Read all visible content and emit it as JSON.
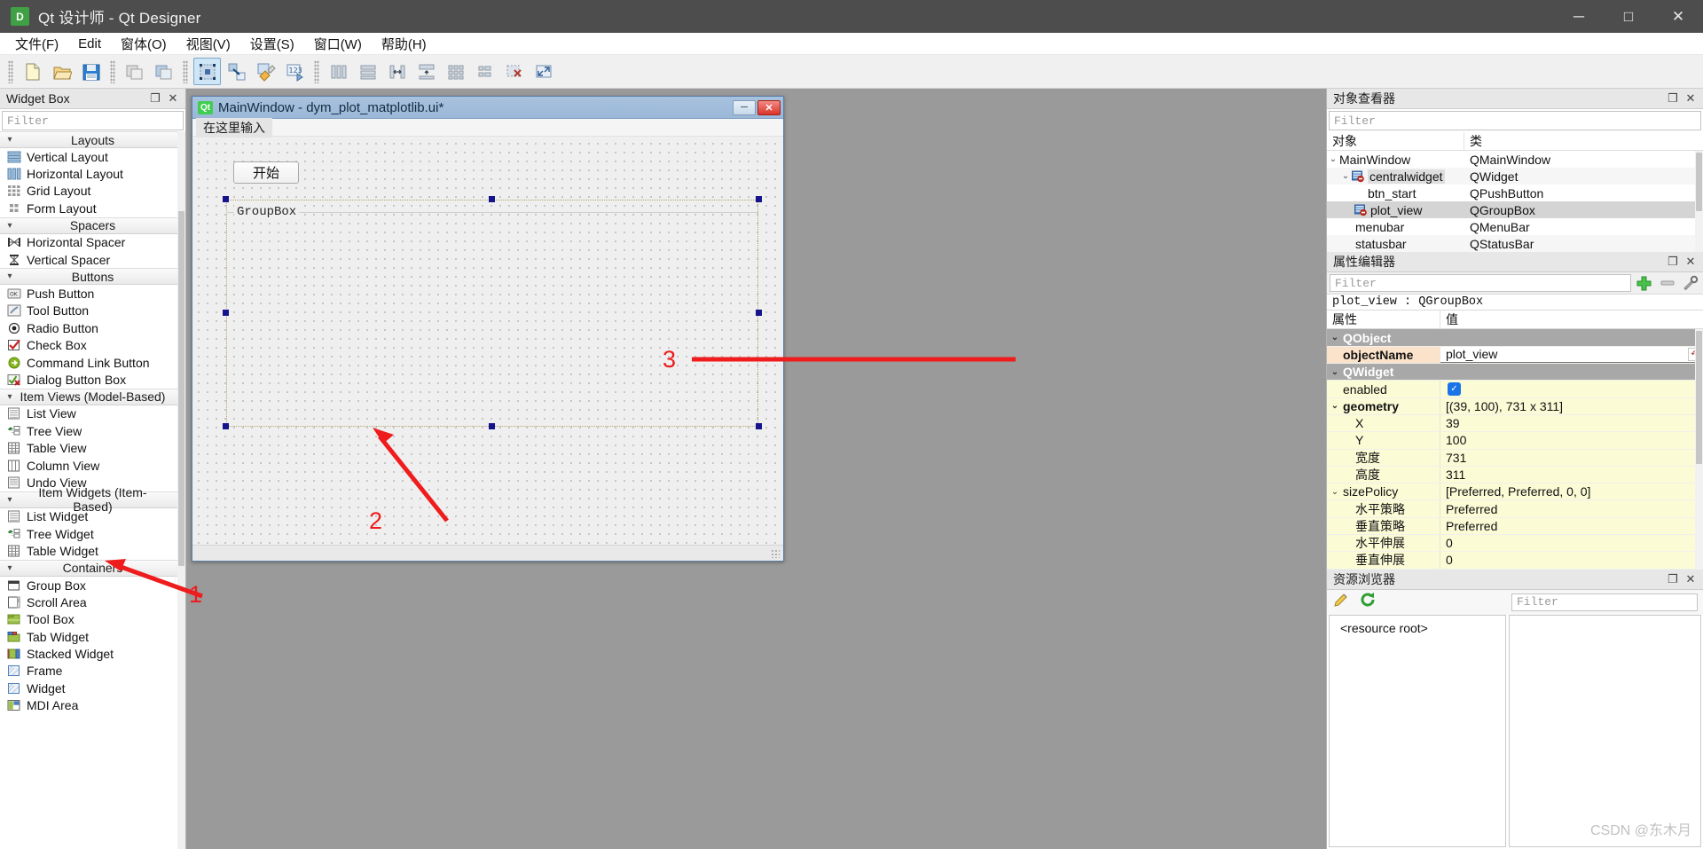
{
  "window": {
    "app_icon_letter": "D",
    "title": "Qt 设计师 - Qt Designer",
    "minimize": "─",
    "maximize": "□",
    "close": "✕"
  },
  "menubar": {
    "items": [
      {
        "label": "文件(F)",
        "name": "menu-file"
      },
      {
        "label": "Edit",
        "name": "menu-edit"
      },
      {
        "label": "窗体(O)",
        "name": "menu-form"
      },
      {
        "label": "视图(V)",
        "name": "menu-view"
      },
      {
        "label": "设置(S)",
        "name": "menu-settings"
      },
      {
        "label": "窗口(W)",
        "name": "menu-window"
      },
      {
        "label": "帮助(H)",
        "name": "menu-help"
      }
    ]
  },
  "toolbar": {
    "groups": [
      [
        "new-file-icon",
        "open-file-icon",
        "save-file-icon"
      ],
      [
        "undo-icon",
        "redo-icon"
      ],
      [
        "edit-widgets-icon",
        "edit-signals-slots-icon",
        "edit-buddies-icon",
        "edit-tab-order-icon"
      ],
      [
        "layout-horizontally-icon",
        "layout-vertically-icon",
        "layout-splitter-horizontal-icon",
        "layout-splitter-vertical-icon",
        "layout-grid-icon",
        "layout-form-icon",
        "break-layout-icon",
        "adjust-size-icon"
      ]
    ]
  },
  "widget_box": {
    "title": "Widget Box",
    "float_icon": "❐",
    "close_icon": "✕",
    "filter_placeholder": "Filter",
    "categories": [
      {
        "name": "Layouts",
        "items": [
          {
            "label": "Vertical Layout",
            "icon": "vertical-layout-icon"
          },
          {
            "label": "Horizontal Layout",
            "icon": "horizontal-layout-icon"
          },
          {
            "label": "Grid Layout",
            "icon": "grid-layout-icon"
          },
          {
            "label": "Form Layout",
            "icon": "form-layout-icon"
          }
        ]
      },
      {
        "name": "Spacers",
        "items": [
          {
            "label": "Horizontal Spacer",
            "icon": "horizontal-spacer-icon"
          },
          {
            "label": "Vertical Spacer",
            "icon": "vertical-spacer-icon"
          }
        ]
      },
      {
        "name": "Buttons",
        "items": [
          {
            "label": "Push Button",
            "icon": "push-button-icon"
          },
          {
            "label": "Tool Button",
            "icon": "tool-button-icon"
          },
          {
            "label": "Radio Button",
            "icon": "radio-button-icon"
          },
          {
            "label": "Check Box",
            "icon": "check-box-icon"
          },
          {
            "label": "Command Link Button",
            "icon": "command-link-button-icon"
          },
          {
            "label": "Dialog Button Box",
            "icon": "dialog-button-box-icon"
          }
        ]
      },
      {
        "name": "Item Views (Model-Based)",
        "items": [
          {
            "label": "List View",
            "icon": "list-view-icon"
          },
          {
            "label": "Tree View",
            "icon": "tree-view-icon"
          },
          {
            "label": "Table View",
            "icon": "table-view-icon"
          },
          {
            "label": "Column View",
            "icon": "column-view-icon"
          },
          {
            "label": "Undo View",
            "icon": "undo-view-icon"
          }
        ]
      },
      {
        "name": "Item Widgets (Item-Based)",
        "items": [
          {
            "label": "List Widget",
            "icon": "list-widget-icon"
          },
          {
            "label": "Tree Widget",
            "icon": "tree-widget-icon"
          },
          {
            "label": "Table Widget",
            "icon": "table-widget-icon"
          }
        ]
      },
      {
        "name": "Containers",
        "items": [
          {
            "label": "Group Box",
            "icon": "group-box-icon"
          },
          {
            "label": "Scroll Area",
            "icon": "scroll-area-icon"
          },
          {
            "label": "Tool Box",
            "icon": "tool-box-icon"
          },
          {
            "label": "Tab Widget",
            "icon": "tab-widget-icon"
          },
          {
            "label": "Stacked Widget",
            "icon": "stacked-widget-icon"
          },
          {
            "label": "Frame",
            "icon": "frame-icon"
          },
          {
            "label": "Widget",
            "icon": "widget-icon"
          },
          {
            "label": "MDI Area",
            "icon": "mdi-area-icon"
          }
        ]
      }
    ]
  },
  "form_window": {
    "icon_letter": "Qt",
    "title": "MainWindow - dym_plot_matplotlib.ui*",
    "minimize": "─",
    "close": "✕",
    "menu_placeholder": "在这里输入",
    "start_button": "开始",
    "groupbox_label": "GroupBox"
  },
  "object_inspector": {
    "title": "对象查看器",
    "float_icon": "❐",
    "close_icon": "✕",
    "filter_placeholder": "Filter",
    "columns": [
      "对象",
      "类"
    ],
    "rows": [
      {
        "name": "MainWindow",
        "class": "QMainWindow",
        "depth": 0,
        "expander": "⌄",
        "icon": false,
        "selected": false
      },
      {
        "name": "centralwidget",
        "class": "QWidget",
        "depth": 1,
        "expander": "⌄",
        "icon": true,
        "selected": false
      },
      {
        "name": "btn_start",
        "class": "QPushButton",
        "depth": 2,
        "expander": "",
        "icon": false,
        "selected": false
      },
      {
        "name": "plot_view",
        "class": "QGroupBox",
        "depth": 2,
        "expander": "",
        "icon": true,
        "selected": true
      },
      {
        "name": "menubar",
        "class": "QMenuBar",
        "depth": 1,
        "expander": "",
        "icon": false,
        "selected": false
      },
      {
        "name": "statusbar",
        "class": "QStatusBar",
        "depth": 1,
        "expander": "",
        "icon": false,
        "selected": false
      }
    ]
  },
  "property_editor": {
    "title": "属性编辑器",
    "float_icon": "❐",
    "close_icon": "✕",
    "filter_placeholder": "Filter",
    "add_icon": "+",
    "remove_icon": "—",
    "configure_icon": "⚒",
    "object_line": "plot_view : QGroupBox",
    "columns": [
      "属性",
      "值"
    ],
    "rows": [
      {
        "key": "QObject",
        "value": "",
        "type": "group",
        "expander": "⌄"
      },
      {
        "key": "objectName",
        "value": "plot_view",
        "type": "objectname",
        "indent": 1,
        "bold": true
      },
      {
        "key": "QWidget",
        "value": "",
        "type": "group",
        "expander": "⌄"
      },
      {
        "key": "enabled",
        "value": "",
        "type": "checkbox",
        "indent": 1,
        "shade": "yellow"
      },
      {
        "key": "geometry",
        "value": "[(39, 100), 731 x 311]",
        "type": "normal",
        "indent": 0,
        "expander": "⌄",
        "bold": true,
        "shade": "yellow"
      },
      {
        "key": "X",
        "value": "39",
        "type": "normal",
        "indent": 2,
        "shade": "yellow"
      },
      {
        "key": "Y",
        "value": "100",
        "type": "normal",
        "indent": 2,
        "shade": "yellow"
      },
      {
        "key": "宽度",
        "value": "731",
        "type": "normal",
        "indent": 2,
        "shade": "yellow"
      },
      {
        "key": "高度",
        "value": "311",
        "type": "normal",
        "indent": 2,
        "shade": "yellow"
      },
      {
        "key": "sizePolicy",
        "value": "[Preferred, Preferred, 0, 0]",
        "type": "normal",
        "indent": 0,
        "expander": "⌄",
        "shade": "yellow"
      },
      {
        "key": "水平策略",
        "value": "Preferred",
        "type": "normal",
        "indent": 2,
        "shade": "yellow"
      },
      {
        "key": "垂直策略",
        "value": "Preferred",
        "type": "normal",
        "indent": 2,
        "shade": "yellow"
      },
      {
        "key": "水平伸展",
        "value": "0",
        "type": "normal",
        "indent": 2,
        "shade": "yellow"
      },
      {
        "key": "垂直伸展",
        "value": "0",
        "type": "normal",
        "indent": 2,
        "shade": "yellow"
      }
    ]
  },
  "resource_browser": {
    "title": "资源浏览器",
    "float_icon": "❐",
    "close_icon": "✕",
    "edit_icon": "pencil-icon",
    "reload_icon": "reload-icon",
    "filter_placeholder": "Filter",
    "tree_root": "<resource root>",
    "watermark": "CSDN @东木月"
  },
  "annotations": {
    "marker_color": "#ee1c1c",
    "markers": [
      {
        "label": "1",
        "target": "group-box-widget-box-item"
      },
      {
        "label": "2",
        "target": "form-canvas-groupbox"
      },
      {
        "label": "3",
        "target": "objectname-property-row"
      }
    ]
  }
}
